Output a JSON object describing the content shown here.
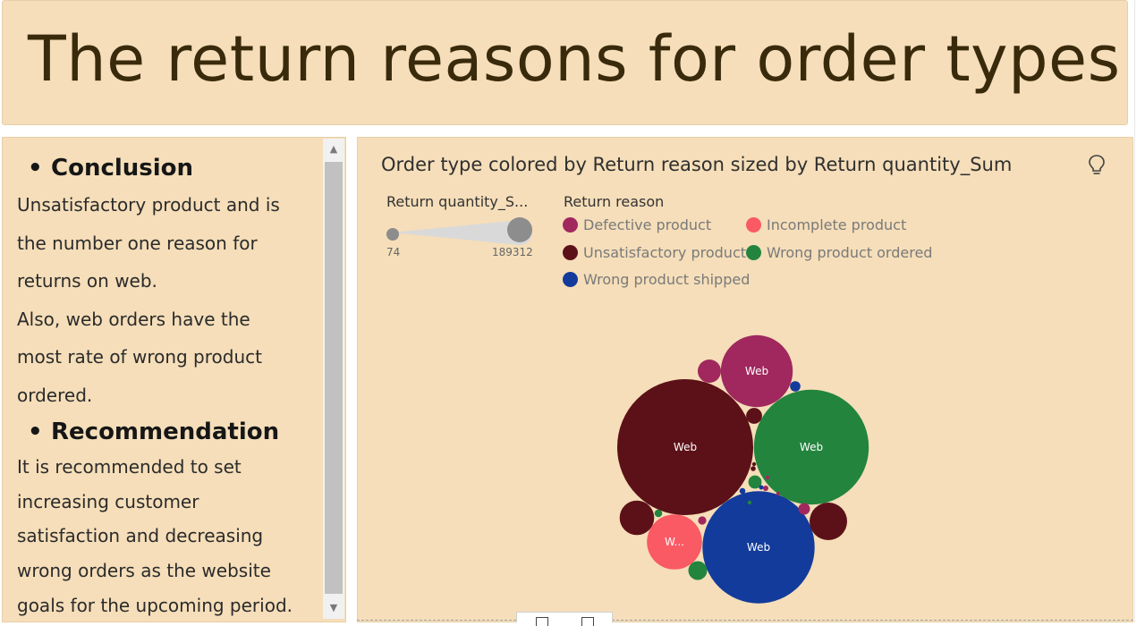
{
  "title": "The return reasons for order types",
  "text_panel": {
    "conclusion_heading": "Conclusion",
    "conclusion_lines": [
      "Unsatisfactory product and is",
      "the number one reason for",
      "returns on web.",
      "Also, web orders have the",
      "most rate of wrong product",
      "ordered."
    ],
    "recommendation_heading": "Recommendation",
    "recommendation_lines": [
      "It is recommended to set",
      "increasing customer",
      "satisfaction and decreasing",
      "wrong orders as the website",
      "goals for the upcoming period."
    ]
  },
  "chart_data": {
    "type": "bubble",
    "title": "Order type colored by Return reason sized by Return quantity_Sum",
    "size_legend": {
      "title": "Return quantity_S...",
      "min_label": "74",
      "max_label": "189312"
    },
    "color_legend": {
      "title": "Return reason",
      "entries": [
        {
          "name": "Defective product",
          "color": "#a0285e"
        },
        {
          "name": "Incomplete product",
          "color": "#fa5a64"
        },
        {
          "name": "Unsatisfactory product",
          "color": "#5c1118"
        },
        {
          "name": "Wrong product ordered",
          "color": "#23843e"
        },
        {
          "name": "Wrong product shipped",
          "color": "#133b9b"
        }
      ]
    },
    "bubbles": [
      {
        "label": "Web",
        "reason": "Unsatisfactory product",
        "value": 189312
      },
      {
        "label": "Web",
        "reason": "Wrong product ordered",
        "value": 135000
      },
      {
        "label": "Web",
        "reason": "Wrong product shipped",
        "value": 129000
      },
      {
        "label": "Web",
        "reason": "Defective product",
        "value": 53000
      },
      {
        "label": "W...",
        "reason": "Incomplete product",
        "value": 31000
      },
      {
        "label": "",
        "reason": "Unsatisfactory product",
        "value": 14500
      },
      {
        "label": "",
        "reason": "Unsatisfactory product",
        "value": 12200
      },
      {
        "label": "",
        "reason": "Defective product",
        "value": 5500
      },
      {
        "label": "",
        "reason": "Wrong product ordered",
        "value": 3600
      },
      {
        "label": "",
        "reason": "Unsatisfactory product",
        "value": 2600
      },
      {
        "label": "",
        "reason": "Wrong product ordered",
        "value": 1800
      },
      {
        "label": "",
        "reason": "Defective product",
        "value": 1400
      },
      {
        "label": "",
        "reason": "Wrong product shipped",
        "value": 1100
      },
      {
        "label": "",
        "reason": "Defective product",
        "value": 700
      },
      {
        "label": "",
        "reason": "Wrong product ordered",
        "value": 600
      },
      {
        "label": "",
        "reason": "Wrong product shipped",
        "value": 350
      },
      {
        "label": "",
        "reason": "Defective product",
        "value": 300
      },
      {
        "label": "",
        "reason": "Unsatisfactory product",
        "value": 250
      },
      {
        "label": "",
        "reason": "Wrong product shipped",
        "value": 200
      },
      {
        "label": "",
        "reason": "Defective product",
        "value": 150
      },
      {
        "label": "",
        "reason": "Wrong product ordered",
        "value": 120
      },
      {
        "label": "",
        "reason": "Unsatisfactory product",
        "value": 100
      },
      {
        "label": "",
        "reason": "Defective product",
        "value": 74
      }
    ]
  }
}
